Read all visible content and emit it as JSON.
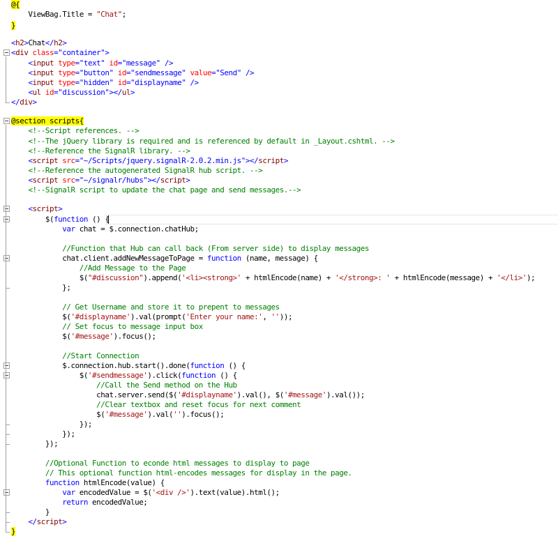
{
  "editor": {
    "language": "Razor (cshtml)",
    "colors": {
      "keyword": "#0000ff",
      "tag": "#800000",
      "attribute": "#ff0000",
      "comment": "#008000",
      "string": "#a31515",
      "razor_highlight": "#ffff00"
    },
    "lines": [
      {
        "segments": [
          {
            "cls": "razor",
            "text": "@{"
          }
        ]
      },
      {
        "segments": [
          {
            "cls": "p",
            "text": "    ViewBag.Title = "
          },
          {
            "cls": "str",
            "text": "\"Chat\""
          },
          {
            "cls": "p",
            "text": ";"
          }
        ]
      },
      {
        "segments": [
          {
            "cls": "razor",
            "text": "}"
          }
        ]
      },
      {
        "segments": []
      },
      {
        "segments": [
          {
            "cls": "k",
            "text": "<"
          },
          {
            "cls": "t",
            "text": "h2"
          },
          {
            "cls": "k",
            "text": ">"
          },
          {
            "cls": "p",
            "text": "Chat"
          },
          {
            "cls": "k",
            "text": "</"
          },
          {
            "cls": "t",
            "text": "h2"
          },
          {
            "cls": "k",
            "text": ">"
          }
        ]
      },
      {
        "segments": [
          {
            "cls": "k",
            "text": "<"
          },
          {
            "cls": "t",
            "text": "div"
          },
          {
            "cls": "p",
            "text": " "
          },
          {
            "cls": "a",
            "text": "class"
          },
          {
            "cls": "k",
            "text": "=\"container\">"
          }
        ]
      },
      {
        "segments": [
          {
            "cls": "p",
            "text": "    "
          },
          {
            "cls": "k",
            "text": "<"
          },
          {
            "cls": "t",
            "text": "input"
          },
          {
            "cls": "p",
            "text": " "
          },
          {
            "cls": "a",
            "text": "type"
          },
          {
            "cls": "k",
            "text": "=\"text\""
          },
          {
            "cls": "p",
            "text": " "
          },
          {
            "cls": "a",
            "text": "id"
          },
          {
            "cls": "k",
            "text": "=\"message\" />"
          }
        ]
      },
      {
        "segments": [
          {
            "cls": "p",
            "text": "    "
          },
          {
            "cls": "k",
            "text": "<"
          },
          {
            "cls": "t",
            "text": "input"
          },
          {
            "cls": "p",
            "text": " "
          },
          {
            "cls": "a",
            "text": "type"
          },
          {
            "cls": "k",
            "text": "=\"button\""
          },
          {
            "cls": "p",
            "text": " "
          },
          {
            "cls": "a",
            "text": "id"
          },
          {
            "cls": "k",
            "text": "=\"sendmessage\""
          },
          {
            "cls": "p",
            "text": " "
          },
          {
            "cls": "a",
            "text": "value"
          },
          {
            "cls": "k",
            "text": "=\"Send\" />"
          }
        ]
      },
      {
        "segments": [
          {
            "cls": "p",
            "text": "    "
          },
          {
            "cls": "k",
            "text": "<"
          },
          {
            "cls": "t",
            "text": "input"
          },
          {
            "cls": "p",
            "text": " "
          },
          {
            "cls": "a",
            "text": "type"
          },
          {
            "cls": "k",
            "text": "=\"hidden\""
          },
          {
            "cls": "p",
            "text": " "
          },
          {
            "cls": "a",
            "text": "id"
          },
          {
            "cls": "k",
            "text": "=\"displayname\" />"
          }
        ]
      },
      {
        "segments": [
          {
            "cls": "p",
            "text": "    "
          },
          {
            "cls": "k",
            "text": "<"
          },
          {
            "cls": "t",
            "text": "ul"
          },
          {
            "cls": "p",
            "text": " "
          },
          {
            "cls": "a",
            "text": "id"
          },
          {
            "cls": "k",
            "text": "=\"discussion\"></"
          },
          {
            "cls": "t",
            "text": "ul"
          },
          {
            "cls": "k",
            "text": ">"
          }
        ]
      },
      {
        "segments": [
          {
            "cls": "k",
            "text": "</"
          },
          {
            "cls": "t",
            "text": "div"
          },
          {
            "cls": "k",
            "text": ">"
          }
        ]
      },
      {
        "segments": []
      },
      {
        "segments": [
          {
            "cls": "razor",
            "text": "@section scripts{"
          }
        ]
      },
      {
        "segments": [
          {
            "cls": "p",
            "text": "    "
          },
          {
            "cls": "c",
            "text": "<!--Script references. -->"
          }
        ]
      },
      {
        "segments": [
          {
            "cls": "p",
            "text": "    "
          },
          {
            "cls": "c",
            "text": "<!--The jQuery library is required and is referenced by default in _Layout.cshtml. -->"
          }
        ]
      },
      {
        "segments": [
          {
            "cls": "p",
            "text": "    "
          },
          {
            "cls": "c",
            "text": "<!--Reference the SignalR library. -->"
          }
        ]
      },
      {
        "segments": [
          {
            "cls": "p",
            "text": "    "
          },
          {
            "cls": "k",
            "text": "<"
          },
          {
            "cls": "t",
            "text": "script"
          },
          {
            "cls": "p",
            "text": " "
          },
          {
            "cls": "a",
            "text": "src"
          },
          {
            "cls": "k",
            "text": "=\"~/Scripts/jquery.signalR-2.0.2.min.js\"></"
          },
          {
            "cls": "t",
            "text": "script"
          },
          {
            "cls": "k",
            "text": ">"
          }
        ]
      },
      {
        "segments": [
          {
            "cls": "p",
            "text": "    "
          },
          {
            "cls": "c",
            "text": "<!--Reference the autogenerated SignalR hub script. -->"
          }
        ]
      },
      {
        "segments": [
          {
            "cls": "p",
            "text": "    "
          },
          {
            "cls": "k",
            "text": "<"
          },
          {
            "cls": "t",
            "text": "script"
          },
          {
            "cls": "p",
            "text": " "
          },
          {
            "cls": "a",
            "text": "src"
          },
          {
            "cls": "k",
            "text": "=\"~/signalr/hubs\"></"
          },
          {
            "cls": "t",
            "text": "script"
          },
          {
            "cls": "k",
            "text": ">"
          }
        ]
      },
      {
        "segments": [
          {
            "cls": "p",
            "text": "    "
          },
          {
            "cls": "c",
            "text": "<!--SignalR script to update the chat page and send messages.-->"
          }
        ]
      },
      {
        "segments": []
      },
      {
        "segments": [
          {
            "cls": "p",
            "text": "    "
          },
          {
            "cls": "k",
            "text": "<"
          },
          {
            "cls": "t",
            "text": "script"
          },
          {
            "cls": "k",
            "text": ">"
          }
        ]
      },
      {
        "segments": [
          {
            "cls": "p",
            "text": "        $("
          },
          {
            "cls": "k",
            "text": "function"
          },
          {
            "cls": "p",
            "text": " () {"
          }
        ]
      },
      {
        "segments": [
          {
            "cls": "p",
            "text": "            "
          },
          {
            "cls": "k",
            "text": "var"
          },
          {
            "cls": "p",
            "text": " chat = $.connection.chatHub;"
          }
        ]
      },
      {
        "segments": []
      },
      {
        "segments": [
          {
            "cls": "p",
            "text": "            "
          },
          {
            "cls": "c",
            "text": "//Function that Hub can call back (From server side) to display messages"
          }
        ]
      },
      {
        "segments": [
          {
            "cls": "p",
            "text": "            chat.client.addNewMessageToPage = "
          },
          {
            "cls": "k",
            "text": "function"
          },
          {
            "cls": "p",
            "text": " (name, message) {"
          }
        ]
      },
      {
        "segments": [
          {
            "cls": "p",
            "text": "                "
          },
          {
            "cls": "c",
            "text": "//Add Message to the Page"
          }
        ]
      },
      {
        "segments": [
          {
            "cls": "p",
            "text": "                $("
          },
          {
            "cls": "str",
            "text": "\"#discussion\""
          },
          {
            "cls": "p",
            "text": ").append("
          },
          {
            "cls": "str",
            "text": "'<li><strong>'"
          },
          {
            "cls": "p",
            "text": " + htmlEncode(name) + "
          },
          {
            "cls": "str",
            "text": "'</strong>: '"
          },
          {
            "cls": "p",
            "text": " + htmlEncode(message) + "
          },
          {
            "cls": "str",
            "text": "'</li>'"
          },
          {
            "cls": "p",
            "text": ");"
          }
        ]
      },
      {
        "segments": [
          {
            "cls": "p",
            "text": "            };"
          }
        ]
      },
      {
        "segments": []
      },
      {
        "segments": [
          {
            "cls": "p",
            "text": "            "
          },
          {
            "cls": "c",
            "text": "// Get Username and store it to prepent to messages"
          }
        ]
      },
      {
        "segments": [
          {
            "cls": "p",
            "text": "            $("
          },
          {
            "cls": "str",
            "text": "'#displayname'"
          },
          {
            "cls": "p",
            "text": ").val(prompt("
          },
          {
            "cls": "str",
            "text": "'Enter your name:'"
          },
          {
            "cls": "p",
            "text": ", "
          },
          {
            "cls": "str",
            "text": "''"
          },
          {
            "cls": "p",
            "text": "));"
          }
        ]
      },
      {
        "segments": [
          {
            "cls": "p",
            "text": "            "
          },
          {
            "cls": "c",
            "text": "// Set focus to message input box"
          }
        ]
      },
      {
        "segments": [
          {
            "cls": "p",
            "text": "            $("
          },
          {
            "cls": "str",
            "text": "'#message'"
          },
          {
            "cls": "p",
            "text": ").focus();"
          }
        ]
      },
      {
        "segments": []
      },
      {
        "segments": [
          {
            "cls": "p",
            "text": "            "
          },
          {
            "cls": "c",
            "text": "//Start Connection"
          }
        ]
      },
      {
        "segments": [
          {
            "cls": "p",
            "text": "            $.connection.hub.start().done("
          },
          {
            "cls": "k",
            "text": "function"
          },
          {
            "cls": "p",
            "text": " () {"
          }
        ]
      },
      {
        "segments": [
          {
            "cls": "p",
            "text": "                $("
          },
          {
            "cls": "str",
            "text": "'#sendmessage'"
          },
          {
            "cls": "p",
            "text": ").click("
          },
          {
            "cls": "k",
            "text": "function"
          },
          {
            "cls": "p",
            "text": " () {"
          }
        ]
      },
      {
        "segments": [
          {
            "cls": "p",
            "text": "                    "
          },
          {
            "cls": "c",
            "text": "//Call the Send method on the Hub"
          }
        ]
      },
      {
        "segments": [
          {
            "cls": "p",
            "text": "                    chat.server.send($("
          },
          {
            "cls": "str",
            "text": "'#displayname'"
          },
          {
            "cls": "p",
            "text": ").val(), $("
          },
          {
            "cls": "str",
            "text": "'#message'"
          },
          {
            "cls": "p",
            "text": ").val());"
          }
        ]
      },
      {
        "segments": [
          {
            "cls": "p",
            "text": "                    "
          },
          {
            "cls": "c",
            "text": "//Clear textbox and reset focus for next comment"
          }
        ]
      },
      {
        "segments": [
          {
            "cls": "p",
            "text": "                    $("
          },
          {
            "cls": "str",
            "text": "'#message'"
          },
          {
            "cls": "p",
            "text": ").val("
          },
          {
            "cls": "str",
            "text": "''"
          },
          {
            "cls": "p",
            "text": ").focus();"
          }
        ]
      },
      {
        "segments": [
          {
            "cls": "p",
            "text": "                });"
          }
        ]
      },
      {
        "segments": [
          {
            "cls": "p",
            "text": "            });"
          }
        ]
      },
      {
        "segments": [
          {
            "cls": "p",
            "text": "        });"
          }
        ]
      },
      {
        "segments": []
      },
      {
        "segments": [
          {
            "cls": "p",
            "text": "        "
          },
          {
            "cls": "c",
            "text": "//Optional Function to econde html messages to display to page"
          }
        ]
      },
      {
        "segments": [
          {
            "cls": "p",
            "text": "        "
          },
          {
            "cls": "c",
            "text": "// This optional function html-encodes messages for display in the page."
          }
        ]
      },
      {
        "segments": [
          {
            "cls": "p",
            "text": "        "
          },
          {
            "cls": "k",
            "text": "function"
          },
          {
            "cls": "p",
            "text": " htmlEncode(value) {"
          }
        ]
      },
      {
        "segments": [
          {
            "cls": "p",
            "text": "            "
          },
          {
            "cls": "k",
            "text": "var"
          },
          {
            "cls": "p",
            "text": " encodedValue = $("
          },
          {
            "cls": "str",
            "text": "'<div />'"
          },
          {
            "cls": "p",
            "text": ").text(value).html();"
          }
        ]
      },
      {
        "segments": [
          {
            "cls": "p",
            "text": "            "
          },
          {
            "cls": "k",
            "text": "return"
          },
          {
            "cls": "p",
            "text": " encodedValue;"
          }
        ]
      },
      {
        "segments": [
          {
            "cls": "p",
            "text": "        }"
          }
        ]
      },
      {
        "segments": [
          {
            "cls": "p",
            "text": "    "
          },
          {
            "cls": "k",
            "text": "</"
          },
          {
            "cls": "t",
            "text": "script"
          },
          {
            "cls": "k",
            "text": ">"
          }
        ]
      },
      {
        "segments": [
          {
            "cls": "razor",
            "text": "}"
          }
        ]
      }
    ]
  }
}
